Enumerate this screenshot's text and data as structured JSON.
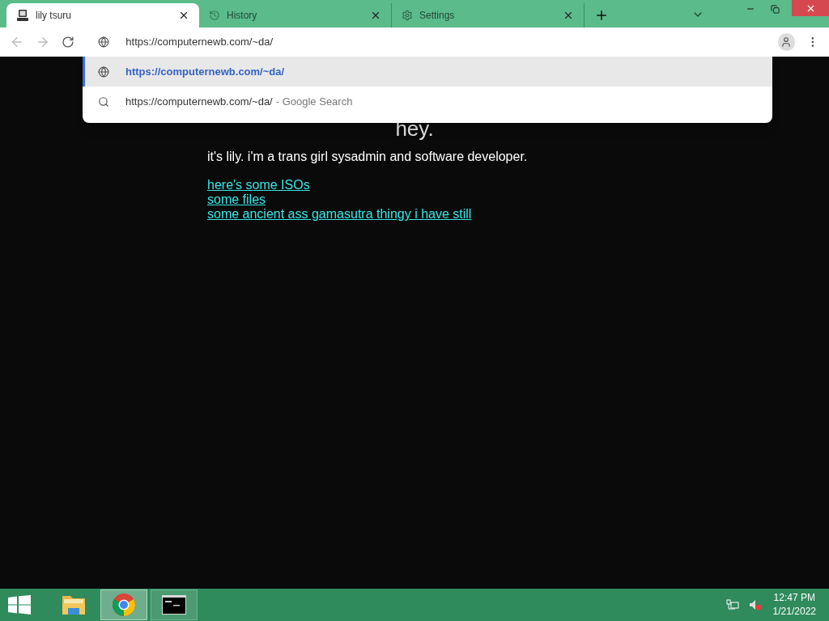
{
  "tabs": [
    {
      "title": "lily tsuru",
      "kind": "computer",
      "selected": true
    },
    {
      "title": "History",
      "kind": "history",
      "selected": false
    },
    {
      "title": "Settings",
      "kind": "gear",
      "selected": false
    }
  ],
  "omnibox": {
    "value": "https://computernewb.com/~da/"
  },
  "suggestions": [
    {
      "kind": "url",
      "text": "https://computernewb.com/~da/",
      "selected": true
    },
    {
      "kind": "search",
      "text": "https://computernewb.com/~da/",
      "suffix": "- Google Search",
      "selected": false
    }
  ],
  "page": {
    "heading": "hey.",
    "intro": "it's lily. i'm a trans girl sysadmin and software developer.",
    "links": [
      "here's some ISOs",
      "some files",
      "some ancient ass gamasutra thingy i have still"
    ]
  },
  "taskbar": {
    "apps": [
      {
        "kind": "folder",
        "active": false
      },
      {
        "kind": "chrome",
        "active": true
      },
      {
        "kind": "terminal",
        "active": false
      }
    ],
    "time": "12:47 PM",
    "date": "1/21/2022"
  }
}
